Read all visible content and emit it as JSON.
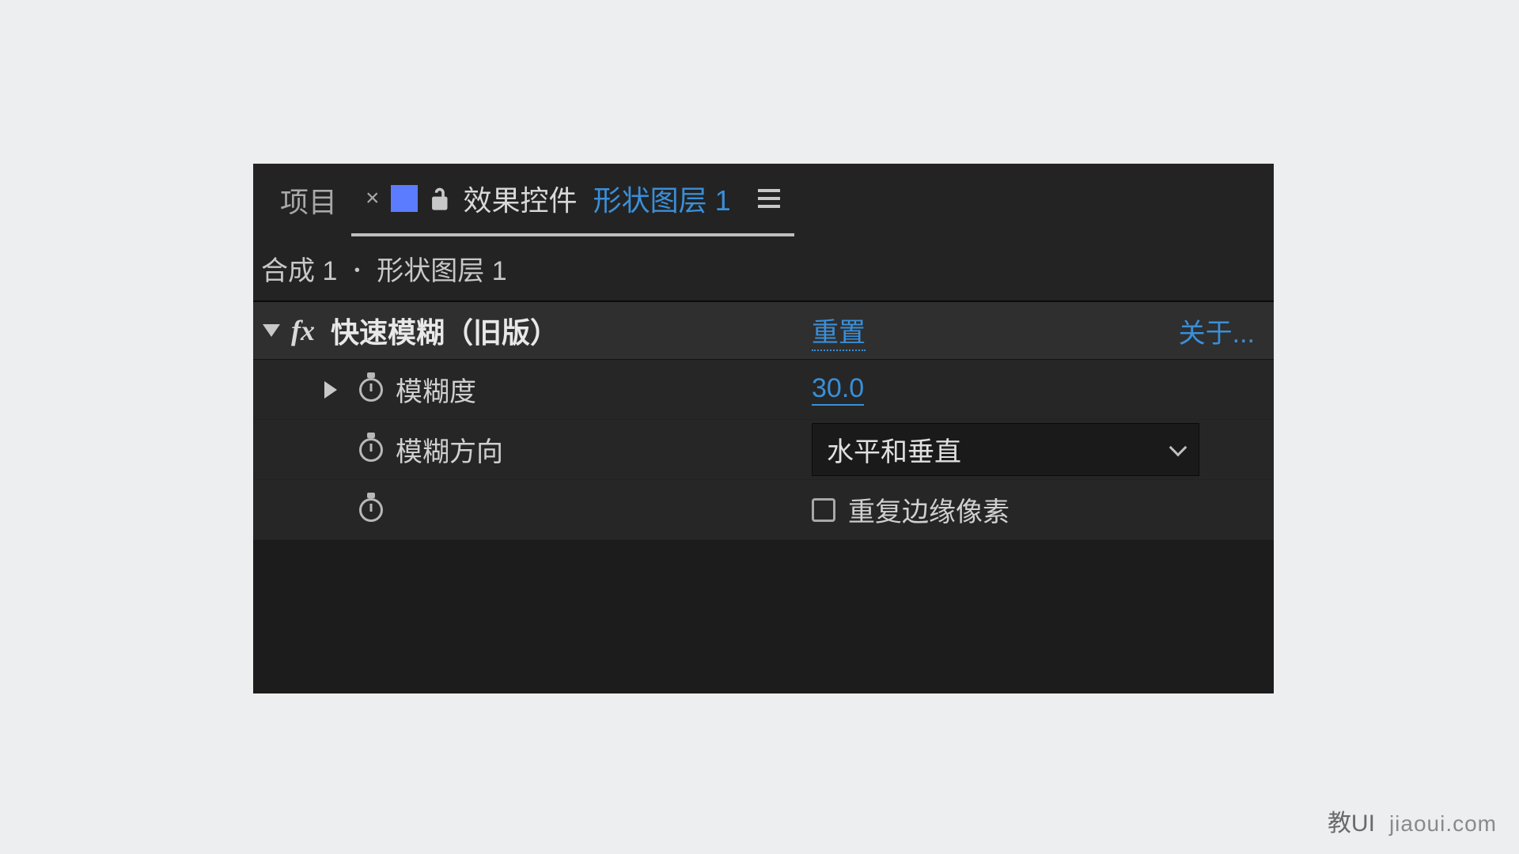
{
  "tabs": {
    "inactive": "项目",
    "activeTitle": "效果控件",
    "activeLayer": "形状图层 1"
  },
  "breadcrumb": {
    "comp": "合成 1",
    "layer": "形状图层 1"
  },
  "effect": {
    "name": "快速模糊（旧版）",
    "reset": "重置",
    "about": "关于..."
  },
  "props": {
    "blurriness": {
      "label": "模糊度",
      "value": "30.0"
    },
    "direction": {
      "label": "模糊方向",
      "value": "水平和垂直"
    },
    "repeatEdge": {
      "label": "重复边缘像素"
    }
  },
  "watermark": {
    "cn": "教UI",
    "en": "jiaoui.com"
  }
}
